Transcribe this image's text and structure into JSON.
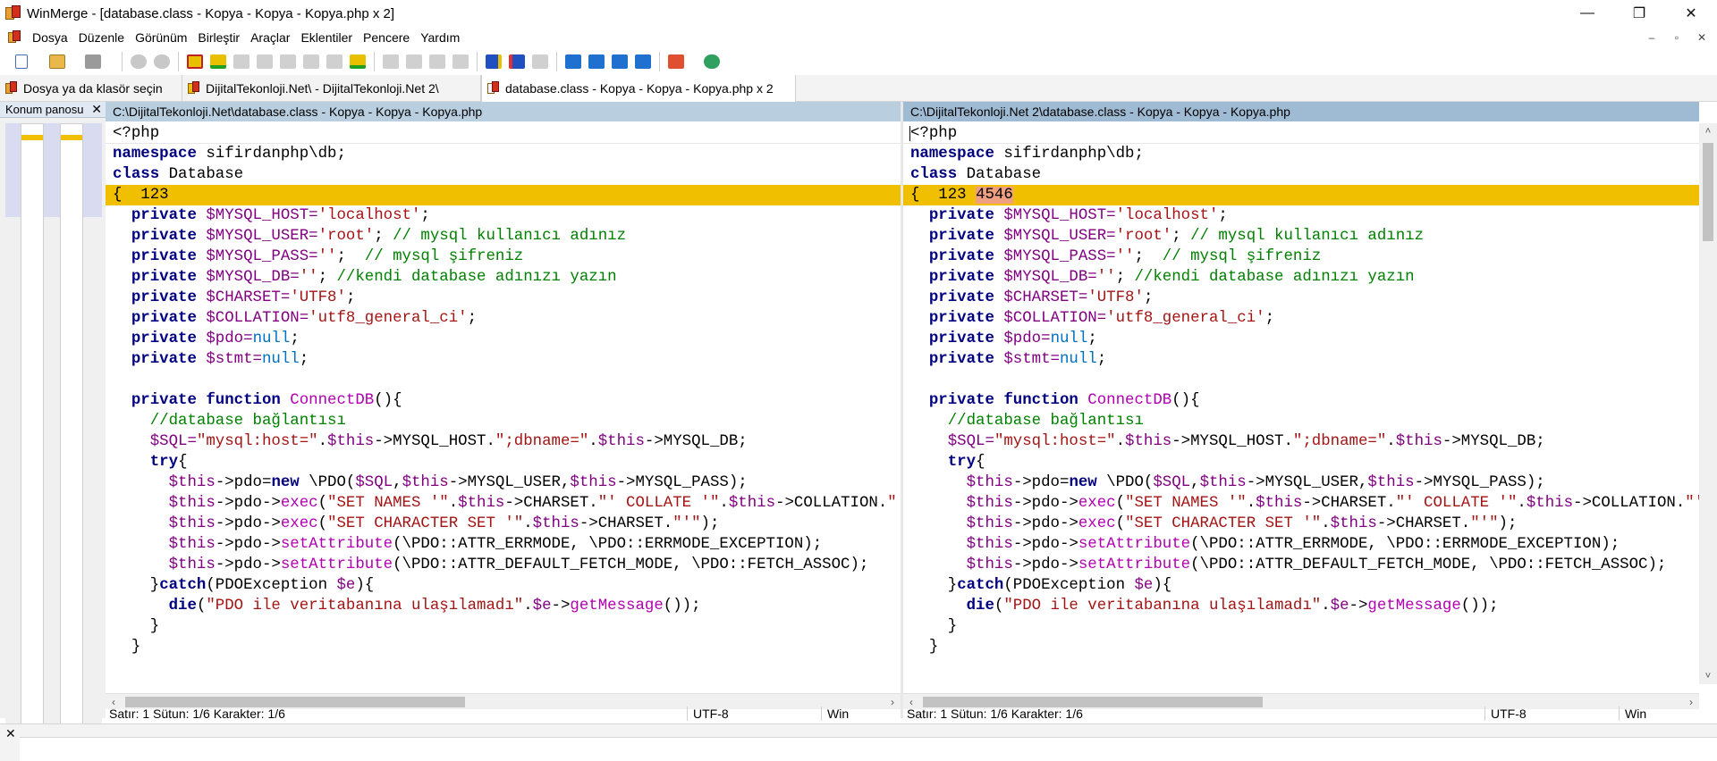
{
  "window": {
    "title": "WinMerge - [database.class - Kopya - Kopya - Kopya.php x 2]",
    "controls": [
      "—",
      "❐",
      "✕"
    ]
  },
  "menu": {
    "items": [
      "Dosya",
      "Düzenle",
      "Görünüm",
      "Birleştir",
      "Araçlar",
      "Eklentiler",
      "Pencere",
      "Yardım"
    ],
    "mdi_controls": [
      "–",
      "▫",
      "✕"
    ]
  },
  "toolbar": {
    "icons": [
      "new-document-icon",
      "open-folder-icon",
      "save-icon",
      "undo-icon",
      "redo-icon",
      "first-diff-icon",
      "prev-diff-icon",
      "next-diff-icon",
      "last-diff-icon",
      "copy-left-icon",
      "copy-right-icon",
      "refresh-icon"
    ]
  },
  "tabs": [
    {
      "label": "Dosya ya da klasör seçin"
    },
    {
      "label": "DijitalTekonloji.Net\\ - DijitalTekonloji.Net 2\\"
    },
    {
      "label": "database.class - Kopya - Kopya - Kopya.php x 2"
    }
  ],
  "location_pane": {
    "title": "Konum panosu",
    "close": "✕"
  },
  "left_pane": {
    "path": "C:\\DijitalTekonloji.Net\\database.class - Kopya - Kopya - Kopya.php",
    "status": {
      "position": "Satır: 1  Sütun: 1/6  Karakter: 1/6",
      "encoding": "UTF-8",
      "eol": "Win"
    },
    "diff_line_tail": ""
  },
  "right_pane": {
    "path": "C:\\DijitalTekonloji.Net 2\\database.class - Kopya - Kopya - Kopya.php",
    "status": {
      "position": "Satır: 1  Sütun: 1/6  Karakter: 1/6",
      "encoding": "UTF-8",
      "eol": "Win"
    },
    "diff_line_tail": "4546"
  },
  "code": [
    [
      {
        "t": "<?php",
        "c": "plain"
      }
    ],
    [
      {
        "t": "namespace",
        "c": "kw"
      },
      {
        "t": " sifirdanphp\\db;",
        "c": "plain"
      }
    ],
    [
      {
        "t": "class",
        "c": "kw"
      },
      {
        "t": " Database",
        "c": "plain"
      }
    ],
    [
      {
        "t": "{  123",
        "c": "plain"
      }
    ],
    [
      {
        "t": "  ",
        "c": "plain"
      },
      {
        "t": "private",
        "c": "kw"
      },
      {
        "t": " $MYSQL_HOST=",
        "c": "var"
      },
      {
        "t": "'localhost'",
        "c": "str"
      },
      {
        "t": ";",
        "c": "plain"
      }
    ],
    [
      {
        "t": "  ",
        "c": "plain"
      },
      {
        "t": "private",
        "c": "kw"
      },
      {
        "t": " $MYSQL_USER=",
        "c": "var"
      },
      {
        "t": "'root'",
        "c": "str"
      },
      {
        "t": "; ",
        "c": "plain"
      },
      {
        "t": "// mysql kullanıcı adınız",
        "c": "cmt"
      }
    ],
    [
      {
        "t": "  ",
        "c": "plain"
      },
      {
        "t": "private",
        "c": "kw"
      },
      {
        "t": " $MYSQL_PASS=",
        "c": "var"
      },
      {
        "t": "''",
        "c": "str"
      },
      {
        "t": ";  ",
        "c": "plain"
      },
      {
        "t": "// mysql şifreniz",
        "c": "cmt"
      }
    ],
    [
      {
        "t": "  ",
        "c": "plain"
      },
      {
        "t": "private",
        "c": "kw"
      },
      {
        "t": " $MYSQL_DB=",
        "c": "var"
      },
      {
        "t": "''",
        "c": "str"
      },
      {
        "t": "; ",
        "c": "plain"
      },
      {
        "t": "//kendi database adınızı yazın",
        "c": "cmt"
      }
    ],
    [
      {
        "t": "  ",
        "c": "plain"
      },
      {
        "t": "private",
        "c": "kw"
      },
      {
        "t": " $CHARSET=",
        "c": "var"
      },
      {
        "t": "'UTF8'",
        "c": "str"
      },
      {
        "t": ";",
        "c": "plain"
      }
    ],
    [
      {
        "t": "  ",
        "c": "plain"
      },
      {
        "t": "private",
        "c": "kw"
      },
      {
        "t": " $COLLATION=",
        "c": "var"
      },
      {
        "t": "'utf8_general_ci'",
        "c": "str"
      },
      {
        "t": ";",
        "c": "plain"
      }
    ],
    [
      {
        "t": "  ",
        "c": "plain"
      },
      {
        "t": "private",
        "c": "kw"
      },
      {
        "t": " $pdo=",
        "c": "var"
      },
      {
        "t": "null",
        "c": "blu"
      },
      {
        "t": ";",
        "c": "plain"
      }
    ],
    [
      {
        "t": "  ",
        "c": "plain"
      },
      {
        "t": "private",
        "c": "kw"
      },
      {
        "t": " $stmt=",
        "c": "var"
      },
      {
        "t": "null",
        "c": "blu"
      },
      {
        "t": ";",
        "c": "plain"
      }
    ],
    [
      {
        "t": "",
        "c": "plain"
      }
    ],
    [
      {
        "t": "  ",
        "c": "plain"
      },
      {
        "t": "private function",
        "c": "kw"
      },
      {
        "t": " ConnectDB",
        "c": "fn"
      },
      {
        "t": "(){",
        "c": "plain"
      }
    ],
    [
      {
        "t": "    ",
        "c": "plain"
      },
      {
        "t": "//database bağlantısı",
        "c": "cmt"
      }
    ],
    [
      {
        "t": "    ",
        "c": "plain"
      },
      {
        "t": "$SQL=",
        "c": "var"
      },
      {
        "t": "\"mysql:host=\"",
        "c": "str"
      },
      {
        "t": ".",
        "c": "plain"
      },
      {
        "t": "$this",
        "c": "var"
      },
      {
        "t": "->MYSQL_HOST.",
        "c": "plain"
      },
      {
        "t": "\";dbname=\"",
        "c": "str"
      },
      {
        "t": ".",
        "c": "plain"
      },
      {
        "t": "$this",
        "c": "var"
      },
      {
        "t": "->MYSQL_DB;",
        "c": "plain"
      }
    ],
    [
      {
        "t": "    ",
        "c": "plain"
      },
      {
        "t": "try",
        "c": "kw"
      },
      {
        "t": "{",
        "c": "plain"
      }
    ],
    [
      {
        "t": "      ",
        "c": "plain"
      },
      {
        "t": "$this",
        "c": "var"
      },
      {
        "t": "->pdo=",
        "c": "plain"
      },
      {
        "t": "new",
        "c": "kw"
      },
      {
        "t": " \\PDO(",
        "c": "plain"
      },
      {
        "t": "$SQL",
        "c": "var"
      },
      {
        "t": ",",
        "c": "plain"
      },
      {
        "t": "$this",
        "c": "var"
      },
      {
        "t": "->MYSQL_USER,",
        "c": "plain"
      },
      {
        "t": "$this",
        "c": "var"
      },
      {
        "t": "->MYSQL_PASS);",
        "c": "plain"
      }
    ],
    [
      {
        "t": "      ",
        "c": "plain"
      },
      {
        "t": "$this",
        "c": "var"
      },
      {
        "t": "->pdo->",
        "c": "plain"
      },
      {
        "t": "exec",
        "c": "fn"
      },
      {
        "t": "(",
        "c": "plain"
      },
      {
        "t": "\"SET NAMES '\"",
        "c": "str"
      },
      {
        "t": ".",
        "c": "plain"
      },
      {
        "t": "$this",
        "c": "var"
      },
      {
        "t": "->CHARSET.",
        "c": "plain"
      },
      {
        "t": "\"' COLLATE '\"",
        "c": "str"
      },
      {
        "t": ".",
        "c": "plain"
      },
      {
        "t": "$this",
        "c": "var"
      },
      {
        "t": "->COLLATION.",
        "c": "plain"
      },
      {
        "t": "\"'\"",
        "c": "str"
      },
      {
        "t": ");",
        "c": "plain"
      }
    ],
    [
      {
        "t": "      ",
        "c": "plain"
      },
      {
        "t": "$this",
        "c": "var"
      },
      {
        "t": "->pdo->",
        "c": "plain"
      },
      {
        "t": "exec",
        "c": "fn"
      },
      {
        "t": "(",
        "c": "plain"
      },
      {
        "t": "\"SET CHARACTER SET '\"",
        "c": "str"
      },
      {
        "t": ".",
        "c": "plain"
      },
      {
        "t": "$this",
        "c": "var"
      },
      {
        "t": "->CHARSET.",
        "c": "plain"
      },
      {
        "t": "\"'\"",
        "c": "str"
      },
      {
        "t": ");",
        "c": "plain"
      }
    ],
    [
      {
        "t": "      ",
        "c": "plain"
      },
      {
        "t": "$this",
        "c": "var"
      },
      {
        "t": "->pdo->",
        "c": "plain"
      },
      {
        "t": "setAttribute",
        "c": "fn"
      },
      {
        "t": "(\\PDO::ATTR_ERRMODE, \\PDO::ERRMODE_EXCEPTION);",
        "c": "plain"
      }
    ],
    [
      {
        "t": "      ",
        "c": "plain"
      },
      {
        "t": "$this",
        "c": "var"
      },
      {
        "t": "->pdo->",
        "c": "plain"
      },
      {
        "t": "setAttribute",
        "c": "fn"
      },
      {
        "t": "(\\PDO::ATTR_DEFAULT_FETCH_MODE, \\PDO::FETCH_ASSOC);",
        "c": "plain"
      }
    ],
    [
      {
        "t": "    }",
        "c": "plain"
      },
      {
        "t": "catch",
        "c": "kw"
      },
      {
        "t": "(PDOException ",
        "c": "plain"
      },
      {
        "t": "$e",
        "c": "var"
      },
      {
        "t": "){",
        "c": "plain"
      }
    ],
    [
      {
        "t": "      ",
        "c": "plain"
      },
      {
        "t": "die",
        "c": "kw"
      },
      {
        "t": "(",
        "c": "plain"
      },
      {
        "t": "\"PDO ile veritabanına ulaşılamadı\"",
        "c": "str"
      },
      {
        "t": ".",
        "c": "plain"
      },
      {
        "t": "$e",
        "c": "var"
      },
      {
        "t": "->",
        "c": "plain"
      },
      {
        "t": "getMessage",
        "c": "fn"
      },
      {
        "t": "());",
        "c": "plain"
      }
    ],
    [
      {
        "t": "    }",
        "c": "plain"
      }
    ],
    [
      {
        "t": "  }",
        "c": "plain"
      }
    ]
  ],
  "diff_line_index": 3,
  "colors": {
    "diff_bg": "#f0c000",
    "diff_word_bg": "#f0a080",
    "keyword": "#000080",
    "variable": "#800080",
    "string": "#a31515",
    "comment": "#008000"
  }
}
